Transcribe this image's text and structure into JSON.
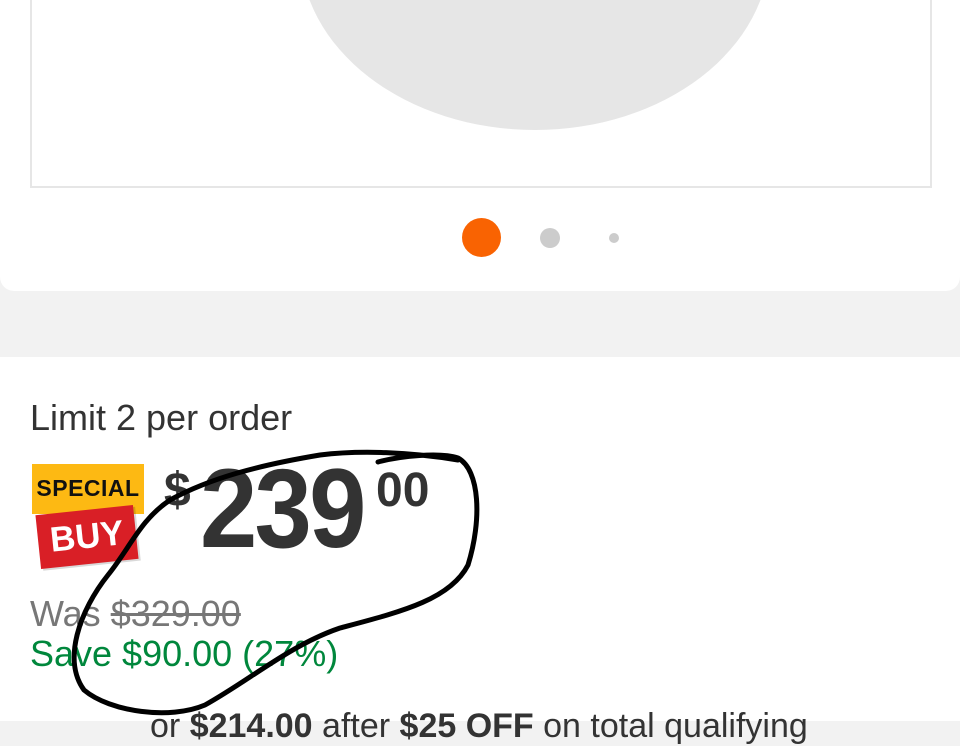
{
  "gallery": {
    "image_alt": "product-image",
    "active_index": 0,
    "dot_count": 3,
    "accent_color": "#f96302"
  },
  "price_block": {
    "limit_text": "Limit 2 per order",
    "badge": {
      "top": "SPECIAL",
      "bottom": "BUY",
      "top_color": "#fdb913",
      "bottom_color": "#d91f26"
    },
    "price": {
      "symbol": "$",
      "dollars": "239",
      "cents": "00"
    },
    "was_label": "Was",
    "was_amount": "$329.00",
    "save_text": "Save $90.00 (27%)",
    "save_color": "#00873c",
    "promo": {
      "prefix": "or ",
      "amount": "$214.00",
      "middle": " after ",
      "discount": "$25 OFF",
      "suffix": " on total qualifying"
    }
  },
  "annotation": {
    "type": "hand-drawn circle",
    "color": "#000000"
  }
}
